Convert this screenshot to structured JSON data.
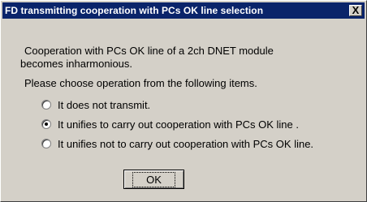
{
  "window": {
    "title": "FD transmitting cooperation with PCs OK line selection",
    "close_label": "X"
  },
  "message": {
    "line1": "Cooperation with PCs OK line of a 2ch DNET module",
    "line2": "becomes inharmonious.",
    "line3": "Please choose operation from the following items."
  },
  "options": [
    {
      "label": "It does not transmit.",
      "checked": false
    },
    {
      "label": "It unifies to carry out cooperation with PCs OK line .",
      "checked": true
    },
    {
      "label": "It unifies not to carry out cooperation with PCs OK line.",
      "checked": false
    }
  ],
  "buttons": {
    "ok_label": "OK"
  },
  "colors": {
    "titlebar": "#0a246a",
    "face": "#d4d0c8"
  }
}
